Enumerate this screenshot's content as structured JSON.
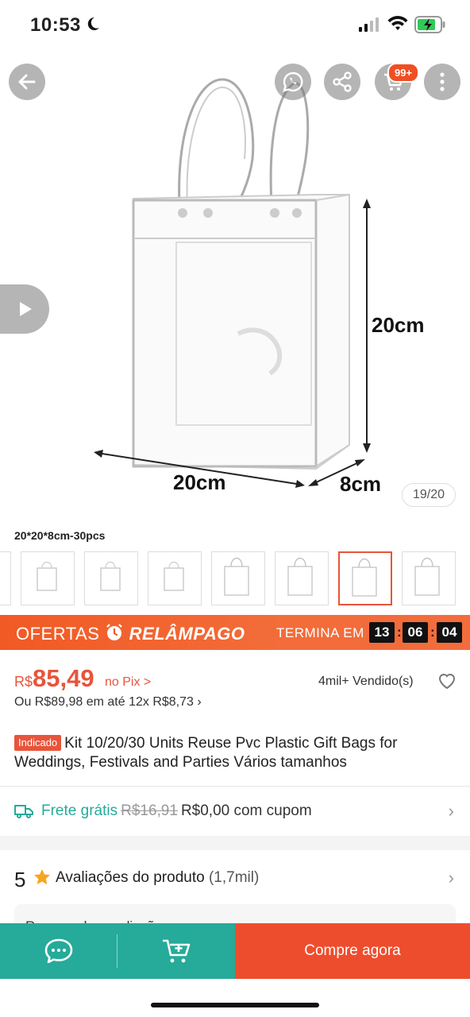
{
  "status_bar": {
    "time": "10:53"
  },
  "product_image": {
    "dimensions": {
      "height": "20cm",
      "width": "20cm",
      "depth": "8cm"
    },
    "counter": "19/20"
  },
  "header_actions": {
    "cart_badge": "99+"
  },
  "variant": {
    "selected_label": "20*20*8cm-30pcs"
  },
  "flash_sale": {
    "label_prefix": "OFERTAS",
    "label_brand": "RELÂMPAGO",
    "ends_label": "TERMINA EM",
    "hours": "13",
    "minutes": "06",
    "seconds": "04"
  },
  "price": {
    "currency": "R$",
    "value": "85,49",
    "pix_label": "no Pix >",
    "installments": "Ou R$89,98 em até 12x R$8,73 ›",
    "sold": "4mil+ Vendido(s)"
  },
  "product": {
    "tag": "Indicado",
    "title": "Kit 10/20/30 Units Reuse Pvc Plastic Gift Bags for Weddings, Festivals and Parties Vários tamanhos"
  },
  "shipping": {
    "free_label": "Frete grátis",
    "old_price": "R$16,91",
    "new_price": "R$0,00 com cupom"
  },
  "ratings": {
    "score": "5",
    "label": "Avaliações do produto",
    "count": "(1,7mil)"
  },
  "review_preview": {
    "text": "Resumo das avaliações"
  },
  "bottom_bar": {
    "buy_label": "Compre agora"
  },
  "colors": {
    "accent": "#ee4d2d",
    "teal": "#26aa99",
    "flash": "#f15a24"
  }
}
